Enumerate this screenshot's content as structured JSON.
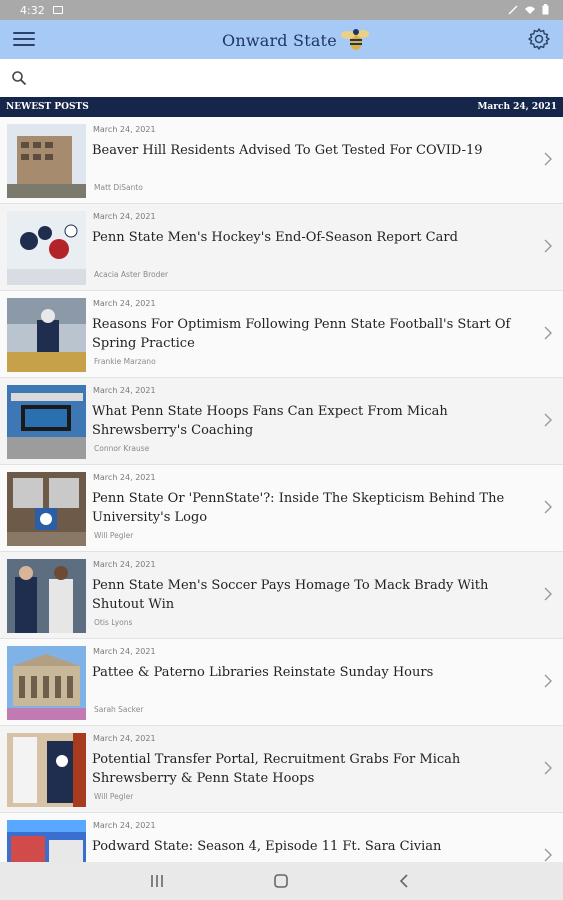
{
  "status_bar": {
    "time": "4:32"
  },
  "header": {
    "title": "Onward State"
  },
  "search": {
    "placeholder": ""
  },
  "section": {
    "label": "NEWEST POSTS",
    "date": "March 24, 2021"
  },
  "posts": [
    {
      "date": "March 24, 2021",
      "title": "Beaver Hill Residents Advised To Get Tested For COVID-19",
      "author": "Matt DiSanto"
    },
    {
      "date": "March 24, 2021",
      "title": "Penn State Men's Hockey's End-Of-Season Report Card",
      "author": "Acacia Aster Broder"
    },
    {
      "date": "March 24, 2021",
      "title": "Reasons For Optimism Following Penn State Football's Start Of Spring Practice",
      "author": "Frankie Marzano"
    },
    {
      "date": "March 24, 2021",
      "title": "What Penn State Hoops Fans Can Expect From Micah Shrewsberry's Coaching",
      "author": "Connor Krause"
    },
    {
      "date": "March 24, 2021",
      "title": "Penn State Or 'PennState'?: Inside The Skepticism Behind The University's Logo",
      "author": "Will Pegler"
    },
    {
      "date": "March 24, 2021",
      "title": "Penn State Men's Soccer Pays Homage To Mack Brady With Shutout Win",
      "author": "Otis Lyons"
    },
    {
      "date": "March 24, 2021",
      "title": "Pattee & Paterno Libraries Reinstate Sunday Hours",
      "author": "Sarah Sacker"
    },
    {
      "date": "March 24, 2021",
      "title": "Potential Transfer Portal, Recruitment Grabs For Micah Shrewsberry & Penn State Hoops",
      "author": "Will Pegler"
    },
    {
      "date": "March 24, 2021",
      "title": "Podward State: Season 4, Episode 11 Ft. Sara Civian",
      "author": ""
    }
  ],
  "colors": {
    "header_bg": "#a7c9f6",
    "section_bg": "#16254a",
    "status_bg": "#a9a9a9"
  }
}
